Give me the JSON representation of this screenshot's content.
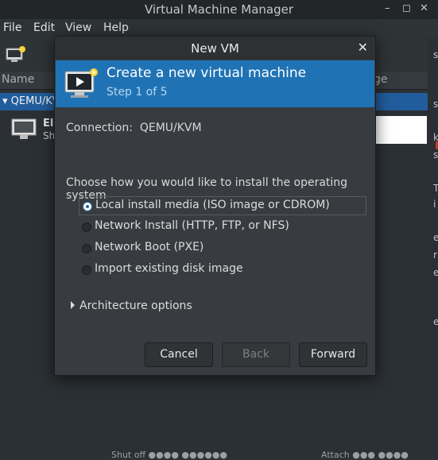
{
  "window": {
    "title": "Virtual Machine Manager",
    "controls": {
      "minimize": "–",
      "maximize": "◻",
      "close": "✕"
    }
  },
  "menu": [
    "File",
    "Edit",
    "View",
    "Help"
  ],
  "list": {
    "col_name": "Name",
    "col_ge": "ge",
    "group": "QEMU/KVM",
    "vm_name": "Ele",
    "vm_status": "Sh"
  },
  "right_edge_chars": [
    "s",
    "s",
    "k",
    "s",
    "T",
    "i",
    "e",
    "r",
    "e",
    "e"
  ],
  "bottom_text": [
    "Shut off  ●●●●  ●●●●●●",
    "Attach  ●●●  ●●●●"
  ],
  "dialog": {
    "title": "New VM",
    "close": "✕",
    "header": "Create a new virtual machine",
    "step": "Step 1 of 5",
    "connection_label": "Connection:",
    "connection_value": "QEMU/KVM",
    "choose": "Choose how you would like to install the operating system",
    "options": [
      {
        "label": "Local install media (ISO image or CDROM)",
        "selected": true
      },
      {
        "label": "Network Install (HTTP, FTP, or NFS)",
        "selected": false
      },
      {
        "label": "Network Boot (PXE)",
        "selected": false
      },
      {
        "label": "Import existing disk image",
        "selected": false
      }
    ],
    "arch": "Architecture options",
    "buttons": {
      "cancel": "Cancel",
      "back": "Back",
      "forward": "Forward"
    }
  },
  "colors": {
    "accent": "#1f73b5",
    "selection": "#215d9c",
    "background": "#2d3236"
  }
}
